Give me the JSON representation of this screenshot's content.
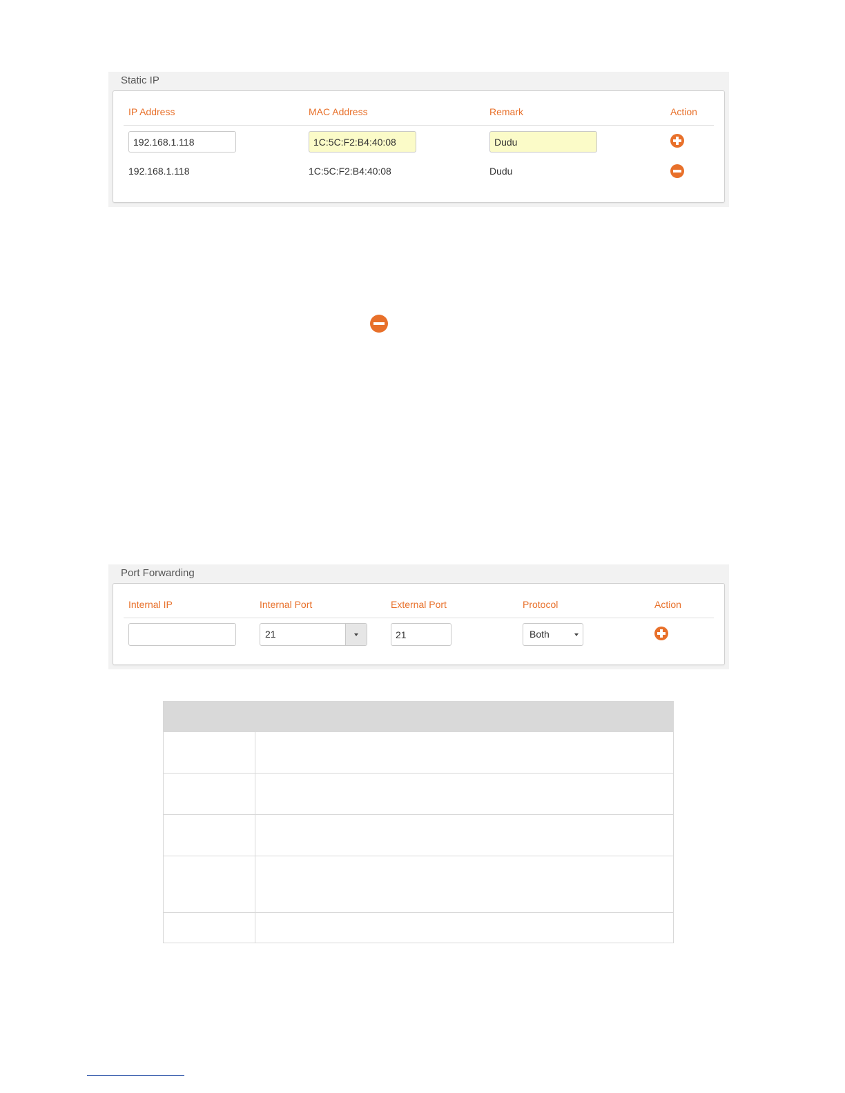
{
  "static_ip": {
    "title": "Static IP",
    "headers": {
      "ip": "IP Address",
      "mac": "MAC Address",
      "remark": "Remark",
      "action": "Action"
    },
    "input_row": {
      "ip": "192.168.1.118",
      "mac": "1C:5C:F2:B4:40:08",
      "remark": "Dudu",
      "action_icon": "plus-circle-icon"
    },
    "rows": [
      {
        "ip": "192.168.1.118",
        "mac": "1C:5C:F2:B4:40:08",
        "remark": "Dudu",
        "action_icon": "minus-circle-icon"
      }
    ]
  },
  "standalone_icon": "minus-circle-icon",
  "port_forwarding": {
    "title": "Port Forwarding",
    "headers": {
      "internal_ip": "Internal IP",
      "internal_port": "Internal Port",
      "external_port": "External Port",
      "protocol": "Protocol",
      "action": "Action"
    },
    "row": {
      "internal_ip": "",
      "internal_port": "21",
      "external_port": "21",
      "protocol": "Both",
      "action_icon": "plus-circle-icon"
    }
  },
  "colors": {
    "accent": "#e8702a",
    "highlight_field": "#fbfbc8",
    "panel_bg": "#f2f2f2",
    "table_header": "#d9d9d9"
  }
}
